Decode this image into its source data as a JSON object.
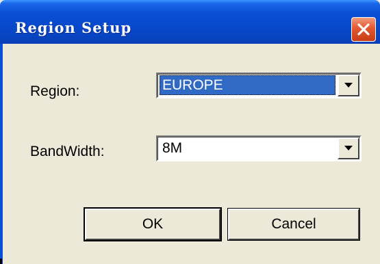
{
  "window": {
    "title": "Region Setup",
    "close_icon": "close-icon"
  },
  "form": {
    "region": {
      "label": "Region:",
      "value": "EUROPE",
      "dropdown_icon": "chevron-down-icon"
    },
    "bandwidth": {
      "label": "BandWidth:",
      "value": "8M",
      "dropdown_icon": "chevron-down-icon"
    }
  },
  "buttons": {
    "ok_label": "OK",
    "cancel_label": "Cancel"
  },
  "colors": {
    "titlebar": "#0A4FD6",
    "close_button": "#E2582F",
    "selection": "#316AC5",
    "dialog_bg": "#ECE9D8"
  }
}
